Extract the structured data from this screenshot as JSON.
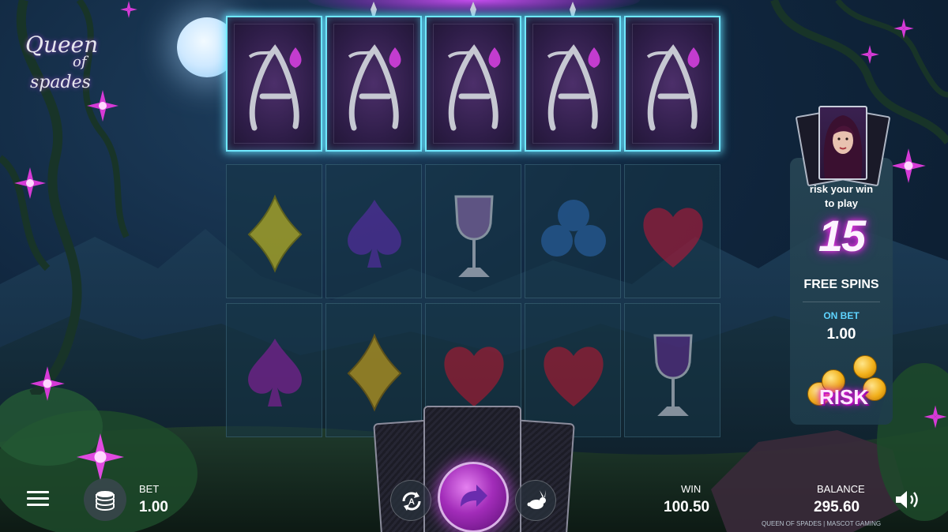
{
  "game": {
    "logo_line1": "Queen",
    "logo_line2": "of",
    "logo_line3": "spades",
    "credits": "QUEEN OF SPADES | MASCOT GAMING"
  },
  "reels": {
    "top_row": [
      "ace-card",
      "ace-card",
      "ace-card",
      "ace-card",
      "ace-card"
    ],
    "rows": [
      [
        "yellow-diamond",
        "purple-spade",
        "goblet",
        "blue-club",
        "red-heart"
      ],
      [
        "purple-spade",
        "yellow-diamond",
        "red-heart",
        "red-heart",
        "goblet"
      ]
    ]
  },
  "risk_panel": {
    "line1": "risk your win",
    "line2": "to play",
    "free_spins_count": "15",
    "free_spins_label": "FREE SPINS",
    "on_bet_label": "ON BET",
    "on_bet_value": "1.00",
    "risk_button_label": "RISK"
  },
  "bottom_bar": {
    "bet_label": "BET",
    "bet_value": "1.00",
    "win_label": "WIN",
    "win_value": "100.50",
    "balance_label": "BALANCE",
    "balance_value": "295.60"
  },
  "colors": {
    "accent_cyan": "#6fe8ff",
    "accent_magenta": "#ff3cf0",
    "on_bet_blue": "#5ed4ff",
    "coin_gold": "#f2b019"
  },
  "icons": {
    "menu": "hamburger-menu-icon",
    "bet": "coin-stack-icon",
    "autoplay": "autoplay-icon",
    "spin": "spin-arrow-icon",
    "turbo": "rabbit-icon",
    "sound": "speaker-icon"
  }
}
